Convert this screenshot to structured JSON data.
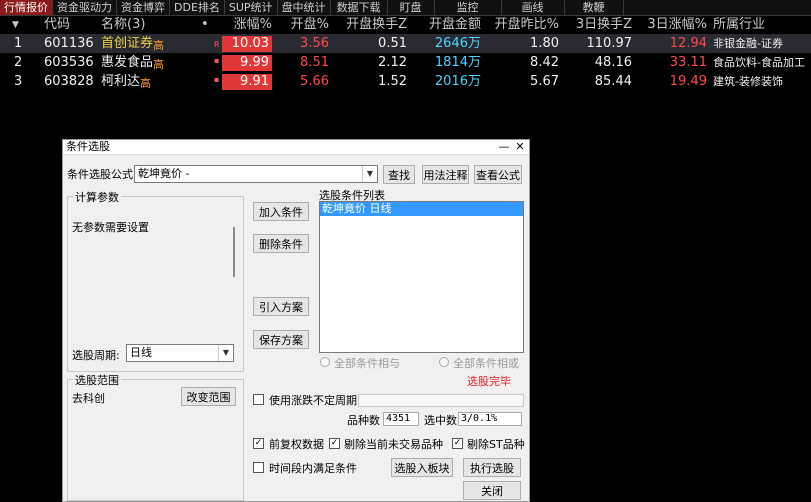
{
  "tabs": [
    "行情报价",
    "资金驱动力",
    "资金博弈",
    "DDE排名",
    "SUP统计",
    "盘中统计",
    "数据下载",
    "盯盘",
    "监控",
    "画线",
    "教鞭"
  ],
  "colors": {
    "accent_red": "#e03838",
    "rise": "#ff4a4a",
    "amount": "#4fd2ff",
    "dialog_bg": "#f0f0f0",
    "selection": "#3399ff"
  },
  "table": {
    "headers": {
      "sort": "▼",
      "code": "代码",
      "name": "名称(3)",
      "dot": "•",
      "chg": "涨幅%",
      "open": "开盘%",
      "open_turn": "开盘换手Z",
      "open_amt": "开盘金额",
      "open_ratio": "开盘昨比%",
      "turn3": "3日换手Z",
      "chg3": "3日涨幅%",
      "industry": "所属行业"
    },
    "rows": [
      {
        "idx": "1",
        "code": "601136",
        "name": "首创证券",
        "tag": "高",
        "mark": "R",
        "chg": "10.03",
        "open": "3.56",
        "open_turn": "0.51",
        "open_amt": "2646万",
        "open_ratio": "1.80",
        "turn3": "110.97",
        "chg3": "12.94",
        "industry": "非银金融-证券"
      },
      {
        "idx": "2",
        "code": "603536",
        "name": "惠发食品",
        "tag": "高",
        "mark": "▪",
        "chg": "9.99",
        "open": "8.51",
        "open_turn": "2.12",
        "open_amt": "1814万",
        "open_ratio": "8.42",
        "turn3": "48.16",
        "chg3": "33.11",
        "industry": "食品饮料-食品加工"
      },
      {
        "idx": "3",
        "code": "603828",
        "name": "柯利达",
        "tag": "高",
        "mark": "▪",
        "chg": "9.91",
        "open": "5.66",
        "open_turn": "1.52",
        "open_amt": "2016万",
        "open_ratio": "5.67",
        "turn3": "85.44",
        "chg3": "19.49",
        "industry": "建筑-装修装饰"
      }
    ]
  },
  "dialog": {
    "title": "条件选股",
    "minimize": "—",
    "close": "✕",
    "formula_label": "条件选股公式",
    "formula_value": "乾坤竟价  -",
    "btn_find": "查找",
    "btn_usage": "用法注释",
    "btn_view": "查看公式",
    "calc_group": "计算参数",
    "no_params": "无参数需要设置",
    "period_label": "选股周期:",
    "period_value": "日线",
    "btn_add": "加入条件",
    "btn_delete": "删除条件",
    "btn_import": "引入方案",
    "btn_save": "保存方案",
    "cond_list_label": "选股条件列表",
    "cond_item": "乾坤竟价  日线",
    "radio_and": "全部条件相与",
    "radio_or": "全部条件相或",
    "status": "选股完毕",
    "range_group": "选股范围",
    "range_value": "去科创",
    "btn_change_range": "改变范围",
    "use_period": "使用涨跌不定周期",
    "stock_count_label": "品种数",
    "stock_count": "4351",
    "selected_label": "选中数",
    "selected_value": "3/0.1%",
    "opt_adjust": "前复权数据",
    "opt_exclude_untraded": "剔除当前未交易品种",
    "opt_exclude_st": "剔除ST品种",
    "opt_time_range": "时间段内满足条件",
    "btn_add_block": "选股入板块",
    "btn_run": "执行选股",
    "btn_close": "关闭"
  }
}
